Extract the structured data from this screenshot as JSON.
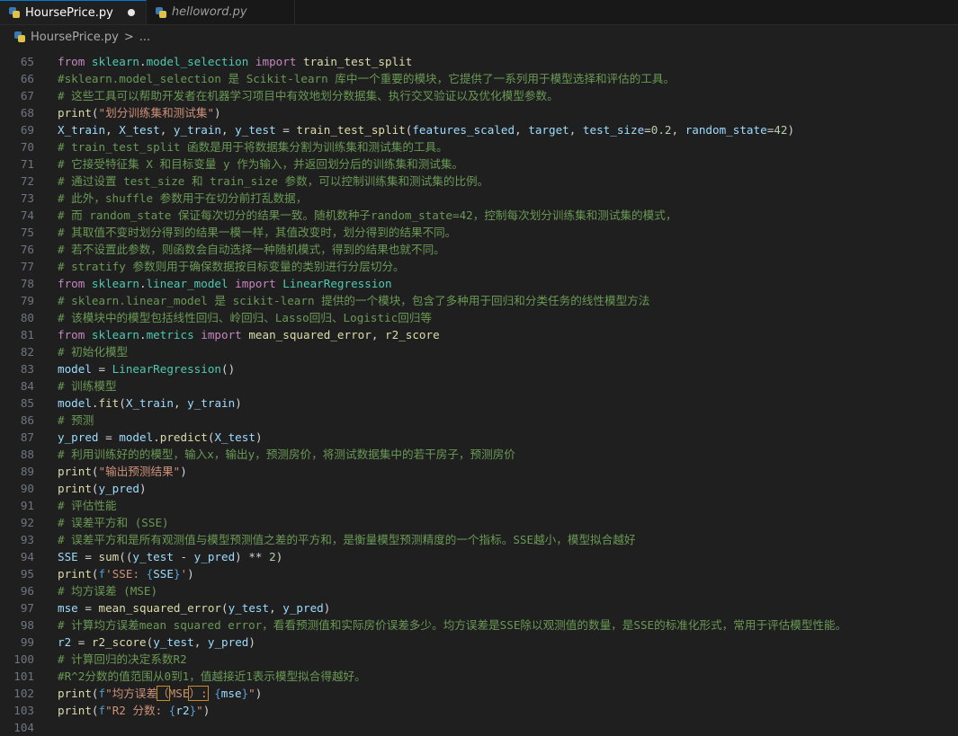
{
  "tabs": [
    {
      "label": "HoursePrice.py",
      "active": true,
      "modified": true
    },
    {
      "label": "helloword.py",
      "active": false
    }
  ],
  "breadcrumb": {
    "file": "HoursePrice.py",
    "separator": ">",
    "symbol": "..."
  },
  "partial_top_line": "64",
  "code_lines": [
    {
      "n": "65",
      "tokens": [
        [
          "kw",
          "from "
        ],
        [
          "mod",
          "sklearn"
        ],
        [
          "op",
          "."
        ],
        [
          "mod",
          "model_selection"
        ],
        [
          "kw",
          " import "
        ],
        [
          "fn",
          "train_test_split"
        ]
      ]
    },
    {
      "n": "66",
      "tokens": [
        [
          "cm",
          "#sklearn.model_selection 是 Scikit-learn 库中一个重要的模块，它提供了一系列用于模型选择和评估的工具。"
        ]
      ]
    },
    {
      "n": "67",
      "tokens": [
        [
          "cm",
          "# 这些工具可以帮助开发者在机器学习项目中有效地划分数据集、执行交叉验证以及优化模型参数。"
        ]
      ]
    },
    {
      "n": "68",
      "tokens": [
        [
          "fn",
          "print"
        ],
        [
          "op",
          "("
        ],
        [
          "str",
          "\"划分训练集和测试集\""
        ],
        [
          "op",
          ")"
        ]
      ]
    },
    {
      "n": "69",
      "tokens": [
        [
          "var",
          "X_train"
        ],
        [
          "op",
          ", "
        ],
        [
          "var",
          "X_test"
        ],
        [
          "op",
          ", "
        ],
        [
          "var",
          "y_train"
        ],
        [
          "op",
          ", "
        ],
        [
          "var",
          "y_test"
        ],
        [
          "op",
          " = "
        ],
        [
          "fn",
          "train_test_split"
        ],
        [
          "op",
          "("
        ],
        [
          "var",
          "features_scaled"
        ],
        [
          "op",
          ", "
        ],
        [
          "var",
          "target"
        ],
        [
          "op",
          ", "
        ],
        [
          "var",
          "test_size"
        ],
        [
          "op",
          "="
        ],
        [
          "num",
          "0.2"
        ],
        [
          "op",
          ", "
        ],
        [
          "var",
          "random_state"
        ],
        [
          "op",
          "="
        ],
        [
          "num",
          "42"
        ],
        [
          "op",
          ")"
        ]
      ]
    },
    {
      "n": "70",
      "tokens": [
        [
          "cm",
          "# train_test_split 函数是用于将数据集分割为训练集和测试集的工具。"
        ]
      ]
    },
    {
      "n": "71",
      "tokens": [
        [
          "cm",
          "# 它接受特征集 X 和目标变量 y 作为输入，并返回划分后的训练集和测试集。"
        ]
      ]
    },
    {
      "n": "72",
      "tokens": [
        [
          "cm",
          "# 通过设置 test_size 和 train_size 参数，可以控制训练集和测试集的比例。"
        ]
      ]
    },
    {
      "n": "73",
      "tokens": [
        [
          "cm",
          "# 此外，shuffle 参数用于在切分前打乱数据，"
        ]
      ]
    },
    {
      "n": "74",
      "tokens": [
        [
          "cm",
          "# 而 random_state 保证每次切分的结果一致。随机数种子random_state=42，控制每次划分训练集和测试集的模式，"
        ]
      ]
    },
    {
      "n": "75",
      "tokens": [
        [
          "cm",
          "# 其取值不变时划分得到的结果一模一样，其值改变时，划分得到的结果不同。"
        ]
      ]
    },
    {
      "n": "76",
      "tokens": [
        [
          "cm",
          "# 若不设置此参数，则函数会自动选择一种随机模式，得到的结果也就不同。"
        ]
      ]
    },
    {
      "n": "77",
      "tokens": [
        [
          "cm",
          "# stratify 参数则用于确保数据按目标变量的类别进行分层切分。"
        ]
      ]
    },
    {
      "n": "78",
      "tokens": [
        [
          "kw",
          "from "
        ],
        [
          "mod",
          "sklearn"
        ],
        [
          "op",
          "."
        ],
        [
          "mod",
          "linear_model"
        ],
        [
          "kw",
          " import "
        ],
        [
          "mod",
          "LinearRegression"
        ]
      ]
    },
    {
      "n": "79",
      "tokens": [
        [
          "cm",
          "# sklearn.linear_model 是 scikit-learn 提供的一个模块，包含了多种用于回归和分类任务的线性模型方法"
        ]
      ]
    },
    {
      "n": "80",
      "tokens": [
        [
          "cm",
          "# 该模块中的模型包括线性回归、岭回归、Lasso回归、Logistic回归等"
        ]
      ]
    },
    {
      "n": "81",
      "tokens": [
        [
          "kw",
          "from "
        ],
        [
          "mod",
          "sklearn"
        ],
        [
          "op",
          "."
        ],
        [
          "mod",
          "metrics"
        ],
        [
          "kw",
          " import "
        ],
        [
          "fn",
          "mean_squared_error"
        ],
        [
          "op",
          ", "
        ],
        [
          "fn",
          "r2_score"
        ]
      ]
    },
    {
      "n": "82",
      "tokens": [
        [
          "cm",
          "# 初始化模型"
        ]
      ]
    },
    {
      "n": "83",
      "tokens": [
        [
          "var",
          "model"
        ],
        [
          "op",
          " = "
        ],
        [
          "mod",
          "LinearRegression"
        ],
        [
          "op",
          "()"
        ]
      ]
    },
    {
      "n": "84",
      "tokens": [
        [
          "cm",
          "# 训练模型"
        ]
      ]
    },
    {
      "n": "85",
      "tokens": [
        [
          "var",
          "model"
        ],
        [
          "op",
          "."
        ],
        [
          "fn",
          "fit"
        ],
        [
          "op",
          "("
        ],
        [
          "var",
          "X_train"
        ],
        [
          "op",
          ", "
        ],
        [
          "var",
          "y_train"
        ],
        [
          "op",
          ")"
        ]
      ]
    },
    {
      "n": "86",
      "tokens": [
        [
          "cm",
          "# 预测"
        ]
      ]
    },
    {
      "n": "87",
      "tokens": [
        [
          "var",
          "y_pred"
        ],
        [
          "op",
          " = "
        ],
        [
          "var",
          "model"
        ],
        [
          "op",
          "."
        ],
        [
          "fn",
          "predict"
        ],
        [
          "op",
          "("
        ],
        [
          "var",
          "X_test"
        ],
        [
          "op",
          ")"
        ]
      ]
    },
    {
      "n": "88",
      "tokens": [
        [
          "cm",
          "# 利用训练好的的模型，输入x，输出y，预测房价，将测试数据集中的若干房子，预测房价"
        ]
      ]
    },
    {
      "n": "89",
      "tokens": [
        [
          "fn",
          "print"
        ],
        [
          "op",
          "("
        ],
        [
          "str",
          "\"输出预测结果\""
        ],
        [
          "op",
          ")"
        ]
      ]
    },
    {
      "n": "90",
      "tokens": [
        [
          "fn",
          "print"
        ],
        [
          "op",
          "("
        ],
        [
          "var",
          "y_pred"
        ],
        [
          "op",
          ")"
        ]
      ]
    },
    {
      "n": "91",
      "tokens": [
        [
          "cm",
          "# 评估性能"
        ]
      ]
    },
    {
      "n": "92",
      "tokens": [
        [
          "cm",
          "# 误差平方和 (SSE)"
        ]
      ]
    },
    {
      "n": "93",
      "tokens": [
        [
          "cm",
          "# 误差平方和是所有观测值与模型预测值之差的平方和，是衡量模型预测精度的一个指标。SSE越小，模型拟合越好"
        ]
      ]
    },
    {
      "n": "94",
      "tokens": [
        [
          "var",
          "SSE"
        ],
        [
          "op",
          " = "
        ],
        [
          "fn",
          "sum"
        ],
        [
          "op",
          "(("
        ],
        [
          "var",
          "y_test"
        ],
        [
          "op",
          " - "
        ],
        [
          "var",
          "y_pred"
        ],
        [
          "op",
          ") ** "
        ],
        [
          "num",
          "2"
        ],
        [
          "op",
          ")"
        ]
      ]
    },
    {
      "n": "95",
      "tokens": [
        [
          "fn",
          "print"
        ],
        [
          "op",
          "("
        ],
        [
          "brace",
          "f"
        ],
        [
          "str",
          "'SSE: "
        ],
        [
          "brace",
          "{"
        ],
        [
          "var",
          "SSE"
        ],
        [
          "brace",
          "}"
        ],
        [
          "str",
          "'"
        ],
        [
          "op",
          ")"
        ]
      ]
    },
    {
      "n": "96",
      "tokens": [
        [
          "cm",
          "# 均方误差 (MSE)"
        ]
      ]
    },
    {
      "n": "97",
      "tokens": [
        [
          "var",
          "mse"
        ],
        [
          "op",
          " = "
        ],
        [
          "fn",
          "mean_squared_error"
        ],
        [
          "op",
          "("
        ],
        [
          "var",
          "y_test"
        ],
        [
          "op",
          ", "
        ],
        [
          "var",
          "y_pred"
        ],
        [
          "op",
          ")"
        ]
      ]
    },
    {
      "n": "98",
      "tokens": [
        [
          "cm",
          "# 计算均方误差mean squared error，看看预测值和实际房价误差多少。均方误差是SSE除以观测值的数量，是SSE的标准化形式，常用于评估模型性能。"
        ]
      ]
    },
    {
      "n": "99",
      "tokens": [
        [
          "var",
          "r2"
        ],
        [
          "op",
          " = "
        ],
        [
          "fn",
          "r2_score"
        ],
        [
          "op",
          "("
        ],
        [
          "var",
          "y_test"
        ],
        [
          "op",
          ", "
        ],
        [
          "var",
          "y_pred"
        ],
        [
          "op",
          ")"
        ]
      ]
    },
    {
      "n": "100",
      "tokens": [
        [
          "cm",
          "# 计算回归的决定系数R2"
        ]
      ]
    },
    {
      "n": "101",
      "tokens": [
        [
          "cm",
          "#R^2分数的值范围从0到1，值越接近1表示模型拟合得越好。"
        ]
      ]
    },
    {
      "n": "102",
      "tokens": [
        [
          "fn",
          "print"
        ],
        [
          "op",
          "("
        ],
        [
          "brace",
          "f"
        ],
        [
          "str",
          "\"均方误差"
        ],
        [
          "str-hl",
          "（"
        ],
        [
          "str",
          "MSE"
        ],
        [
          "str-hl",
          "）:"
        ],
        [
          "str",
          " "
        ],
        [
          "brace",
          "{"
        ],
        [
          "var",
          "mse"
        ],
        [
          "brace",
          "}"
        ],
        [
          "str",
          "\""
        ],
        [
          "op",
          ")"
        ]
      ]
    },
    {
      "n": "103",
      "tokens": [
        [
          "fn",
          "print"
        ],
        [
          "op",
          "("
        ],
        [
          "brace",
          "f"
        ],
        [
          "str",
          "\"R2 分数: "
        ],
        [
          "brace",
          "{"
        ],
        [
          "var",
          "r2"
        ],
        [
          "brace",
          "}"
        ],
        [
          "str",
          "\""
        ],
        [
          "op",
          ")"
        ]
      ]
    },
    {
      "n": "104",
      "tokens": []
    }
  ],
  "colors": {
    "background": "#1f1f1f",
    "keyword": "#c586c0",
    "module": "#4ec9b0",
    "function": "#dcdcaa",
    "variable": "#9cdcfe",
    "string": "#ce9178",
    "number": "#b5cea8",
    "comment": "#6a9955"
  }
}
